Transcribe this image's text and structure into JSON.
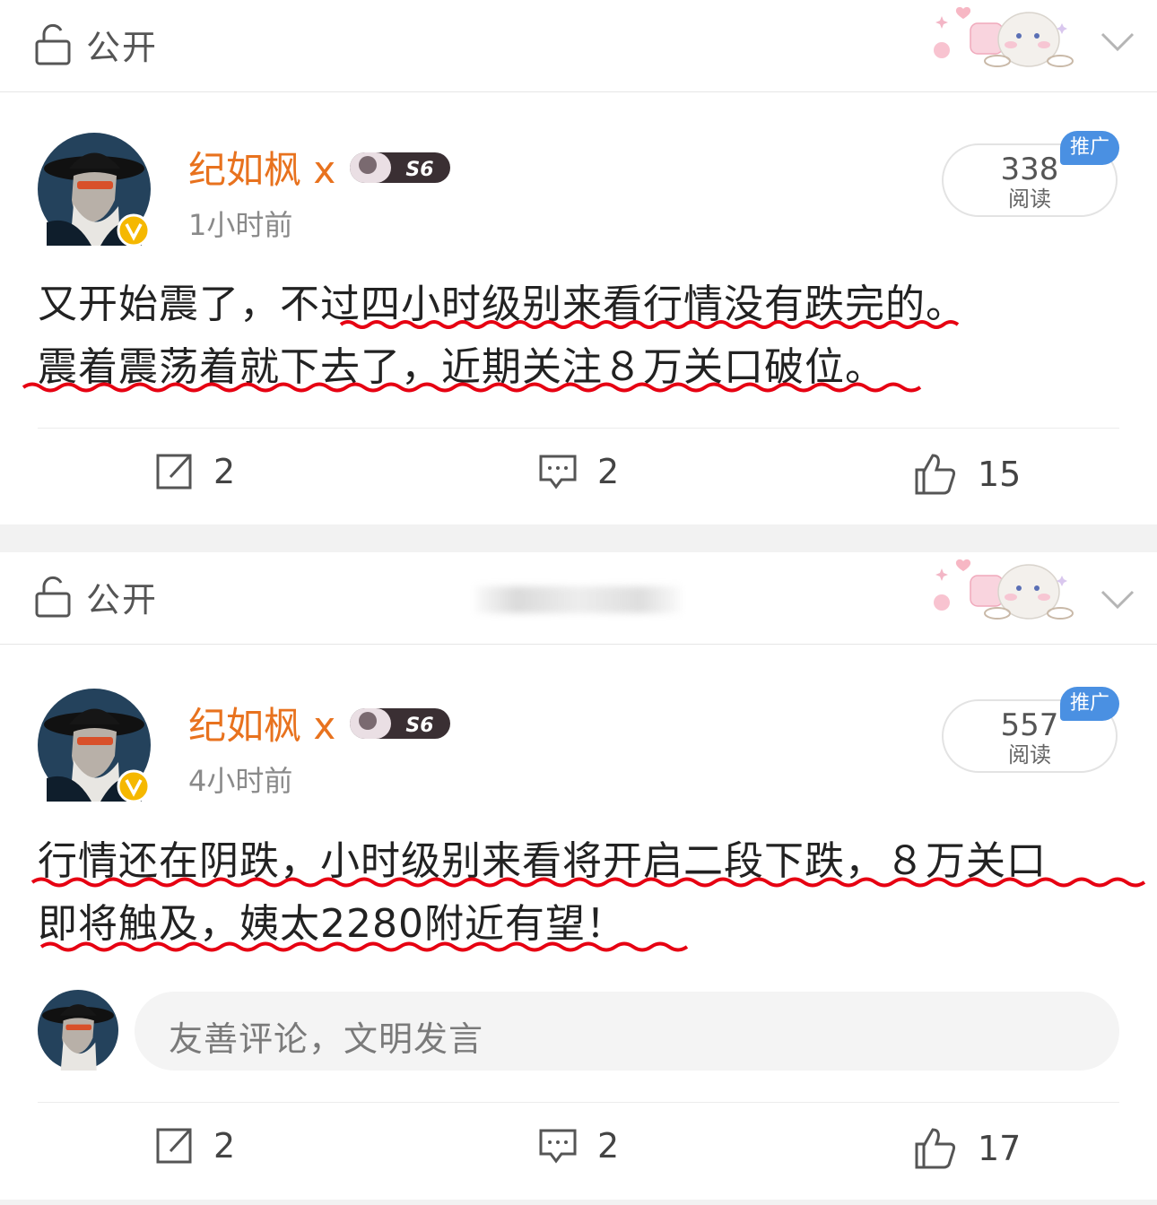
{
  "posts": [
    {
      "visibility": "公开",
      "author": "纪如枫 x",
      "fan_badge": "S6",
      "time": "1小时前",
      "reads": "338",
      "reads_label": "阅读",
      "promo": "推广",
      "text_line1": "又开始震了，不过四小时级别来看行情没有跌完的。",
      "text_line2": "震着震荡着就下去了，近期关注８万关口破位。",
      "repost_count": "2",
      "comment_count": "2",
      "like_count": "15"
    },
    {
      "visibility": "公开",
      "author": "纪如枫 x",
      "fan_badge": "S6",
      "time": "4小时前",
      "reads": "557",
      "reads_label": "阅读",
      "promo": "推广",
      "text_line1": "行情还在阴跌，小时级别来看将开启二段下跌，８万关口",
      "text_line2": "即将触及，姨太2280附近有望！",
      "comment_placeholder": "友善评论，文明发言",
      "repost_count": "2",
      "comment_count": "2",
      "like_count": "17"
    }
  ],
  "colors": {
    "author": "#e8721e",
    "promo": "#4a90e2",
    "underline": "#e60012",
    "separator": "#f2f2f2"
  },
  "icons": [
    "lock-open-icon",
    "chevron-down-icon",
    "repost-icon",
    "comment-icon",
    "like-icon",
    "verified-v-icon",
    "sticker-decoration"
  ]
}
